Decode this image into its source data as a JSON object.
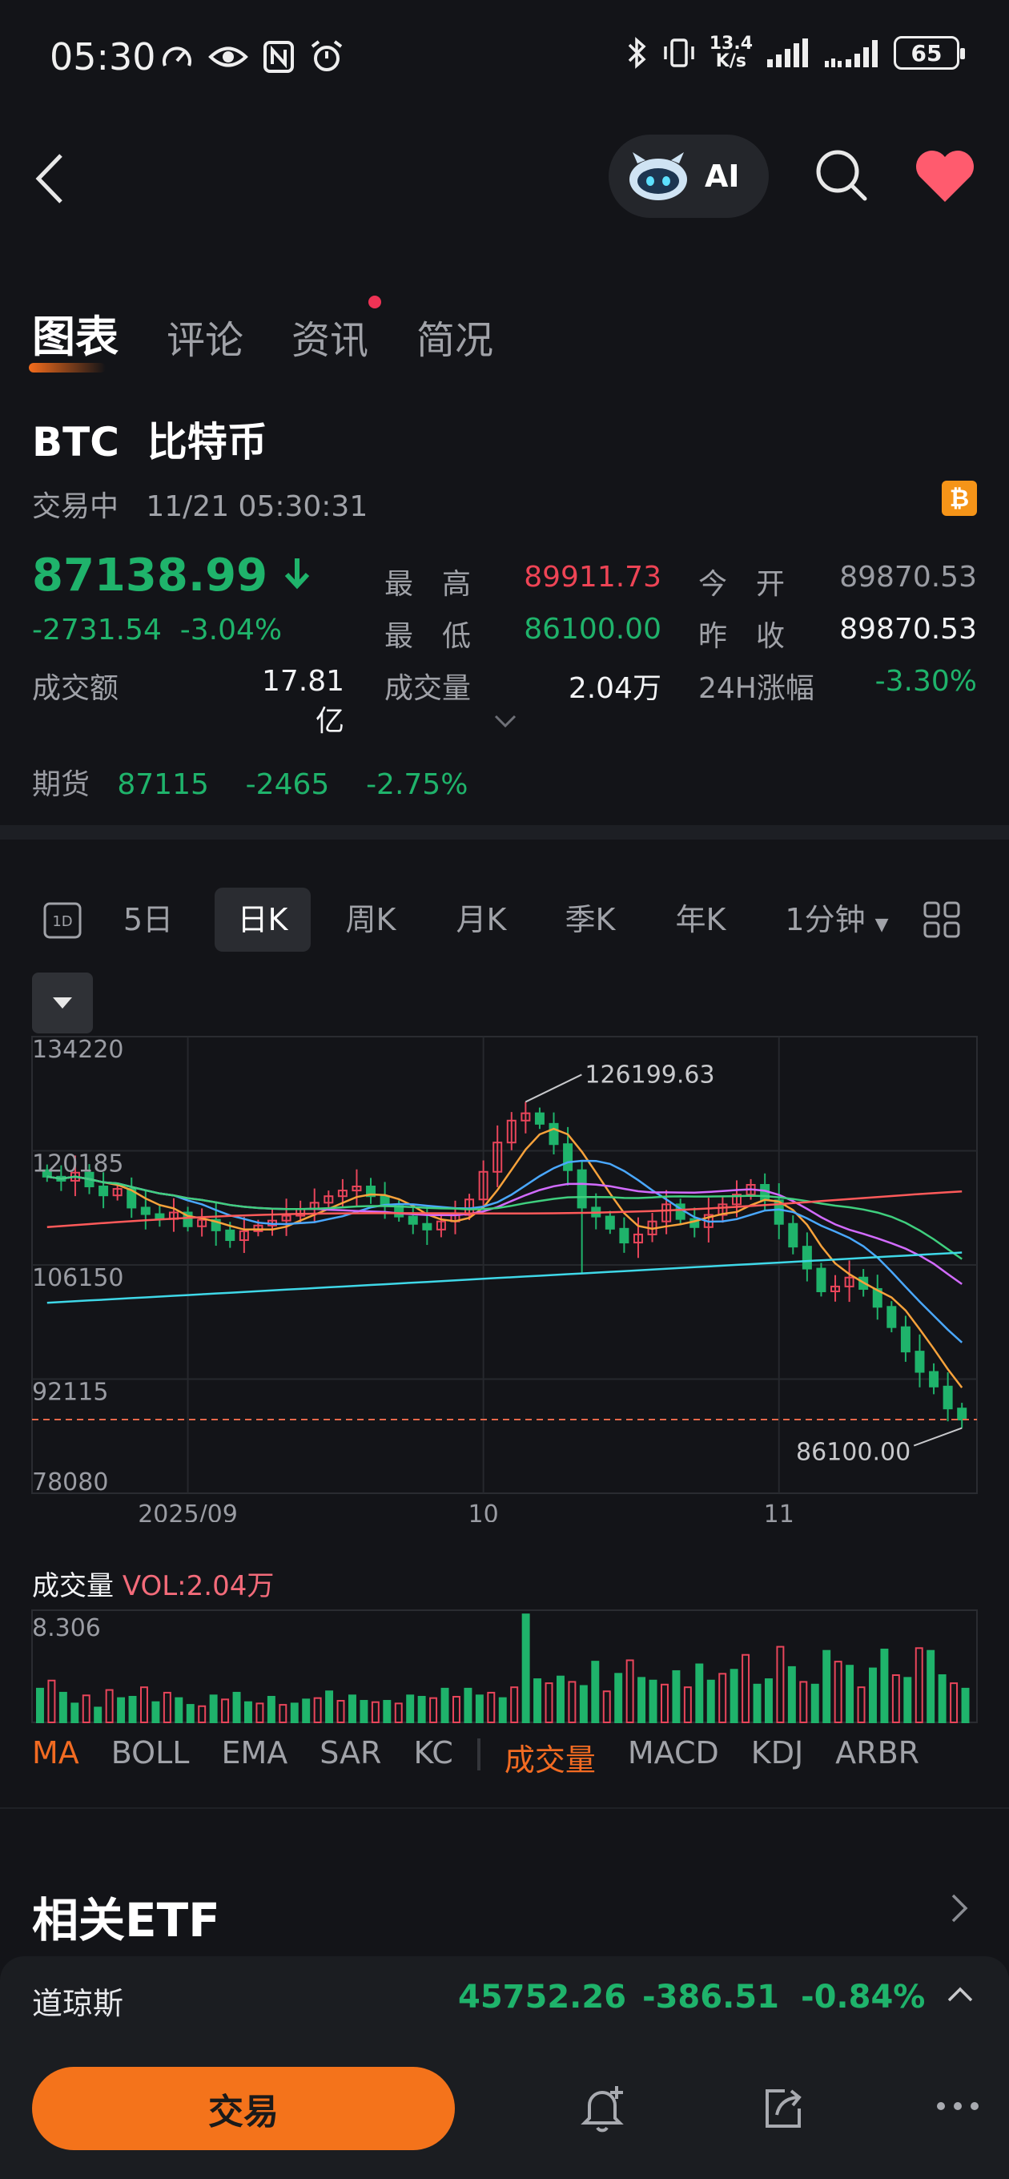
{
  "status_bar": {
    "time": "05:30",
    "net_speed_top": "13.4",
    "net_speed_bottom": "K/s",
    "battery": "65"
  },
  "header": {
    "ai_label": "AI"
  },
  "tabs": [
    {
      "label": "图表",
      "active": true
    },
    {
      "label": "评论",
      "active": false
    },
    {
      "label": "资讯",
      "active": false,
      "dot": true
    },
    {
      "label": "简况",
      "active": false
    }
  ],
  "quote": {
    "ticker": "BTC",
    "name": "比特币",
    "status": "交易中",
    "datetime": "11/21 05:30:31",
    "badge": "₿",
    "price": "87138.99",
    "change": "-2731.54",
    "change_pct": "-3.04%",
    "stats": {
      "high_label": "最　高",
      "high": "89911.73",
      "open_label": "今　开",
      "open": "89870.53",
      "low_label": "最　低",
      "low": "86100.00",
      "prev_close_label": "昨　收",
      "prev_close": "89870.53",
      "turnover_label": "成交额",
      "turnover": "17.81亿",
      "volume_label": "成交量",
      "volume": "2.04万",
      "change24h_label": "24H涨幅",
      "change24h": "-3.30%"
    },
    "futures": {
      "label": "期货",
      "price": "87115",
      "change": "-2465",
      "change_pct": "-2.75%"
    }
  },
  "periods": [
    "5日",
    "日K",
    "周K",
    "月K",
    "季K",
    "年K",
    "1分钟"
  ],
  "period_active": "日K",
  "chart_data": {
    "type": "candlestick",
    "y_ticks": [
      "134220",
      "120185",
      "106150",
      "92115",
      "78080"
    ],
    "ylim": [
      78080,
      134220
    ],
    "x_ticks": [
      "2025/09",
      "10",
      "11"
    ],
    "annotations": {
      "max": "126199.63",
      "min": "86100.00"
    },
    "current_price_line": 87139,
    "ma_colors": {
      "ma5": "#f7a23b",
      "ma10": "#4aa8ff",
      "ma20": "#d26bff",
      "ma30": "#3fcf7e",
      "ma60": "#ff5a5a",
      "ma120": "#3fd8e8"
    },
    "closes": [
      117000,
      116500,
      117500,
      115800,
      114700,
      115500,
      113200,
      112400,
      111800,
      112600,
      110900,
      111700,
      110400,
      109200,
      110300,
      111000,
      111600,
      112200,
      113000,
      113800,
      114600,
      115300,
      115800,
      114600,
      113400,
      112100,
      111200,
      110500,
      111500,
      112300,
      114200,
      117600,
      121200,
      123900,
      124800,
      123500,
      121000,
      117800,
      113200,
      112100,
      110600,
      108900,
      109900,
      111500,
      113600,
      111800,
      110800,
      112300,
      113600,
      114800,
      116000,
      114100,
      111200,
      108400,
      105700,
      102900,
      103500,
      104600,
      103200,
      101000,
      98500,
      95500,
      93000,
      91200,
      88500,
      87139
    ]
  },
  "volume": {
    "title": "成交量",
    "value_label": "VOL:2.04万",
    "y_tick": "8.306",
    "bars": [
      2.5,
      3.1,
      2.2,
      1.4,
      2.0,
      1.1,
      2.4,
      1.8,
      1.9,
      2.6,
      1.5,
      2.2,
      1.8,
      1.3,
      1.2,
      2.0,
      1.7,
      2.2,
      1.5,
      1.4,
      1.9,
      1.3,
      1.4,
      1.7,
      1.8,
      2.3,
      1.6,
      2.0,
      1.6,
      1.5,
      1.6,
      1.4,
      2.0,
      1.9,
      1.8,
      2.5,
      1.9,
      2.5,
      2.0,
      2.2,
      1.8,
      2.6,
      8.0,
      3.2,
      2.9,
      3.4,
      3.0,
      2.7,
      4.5,
      2.3,
      3.6,
      4.6,
      3.3,
      3.1,
      2.8,
      3.8,
      2.6,
      4.3,
      3.1,
      3.6,
      3.9,
      5.0,
      2.8,
      3.2,
      5.6,
      4.1,
      3.0,
      2.8,
      5.3,
      4.5,
      4.2,
      2.6,
      4.0,
      5.4,
      3.5,
      3.3,
      5.5,
      5.3,
      3.5,
      2.9,
      2.5
    ],
    "ylim": [
      0,
      8.306
    ]
  },
  "indicators": [
    "MA",
    "BOLL",
    "EMA",
    "SAR",
    "KC",
    "成交量",
    "MACD",
    "KDJ",
    "ARBR"
  ],
  "indicator_active": [
    "MA",
    "成交量"
  ],
  "related_etf": "相关ETF",
  "bottom_bar": {
    "index_name": "道琼斯",
    "index_value": "45752.26",
    "index_change": "-386.51",
    "index_pct": "-0.84%",
    "trade_label": "交易"
  }
}
